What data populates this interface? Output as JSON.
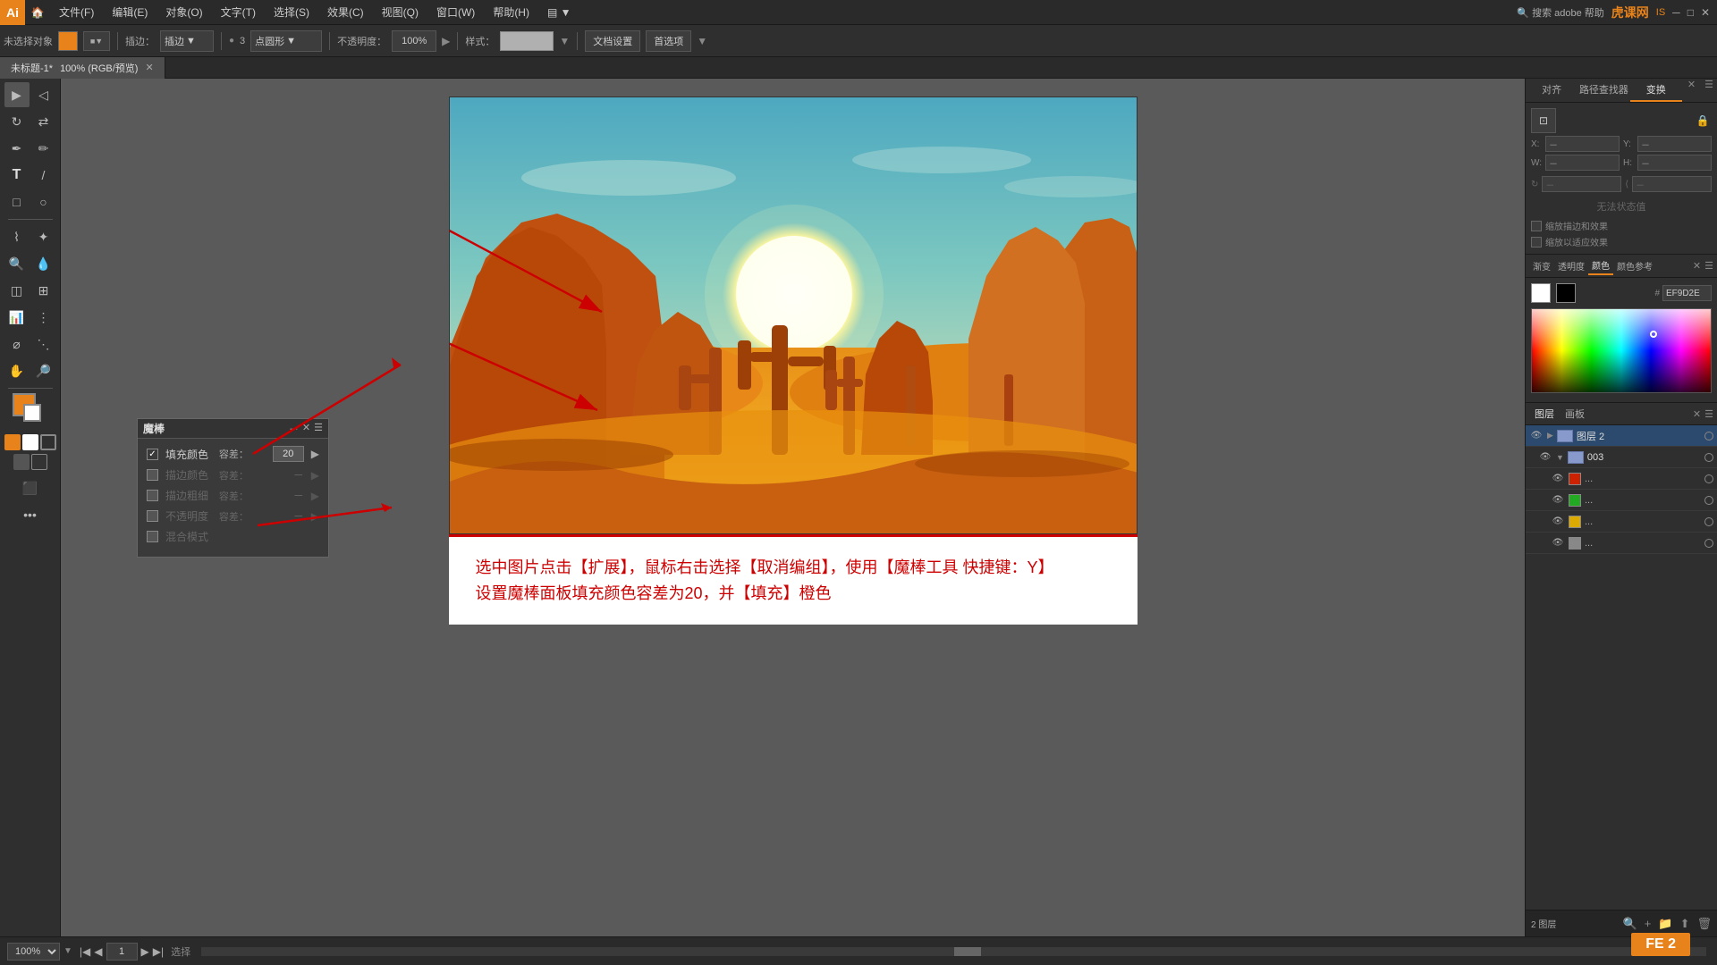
{
  "app": {
    "logo": "Ai",
    "title": "Adobe Illustrator"
  },
  "menu": {
    "items": [
      "文件(F)",
      "编辑(E)",
      "对象(O)",
      "文字(T)",
      "选择(S)",
      "效果(C)",
      "视图(Q)",
      "窗口(W)",
      "帮助(H)"
    ]
  },
  "toolbar": {
    "color_label": "未选择对象",
    "stroke_label": "描边：",
    "blend_label": "插边：",
    "opacity_label": "不透明度：",
    "opacity_value": "100%",
    "style_label": "样式：",
    "doc_btn": "文档设置",
    "pref_btn": "首选项",
    "brush_size": "3",
    "brush_type": "点圆形"
  },
  "tab": {
    "name": "未标题-1*",
    "mode": "100% (RGB/预览)"
  },
  "magic_wand": {
    "title": "魔棒",
    "fill_color_label": "填充颜色",
    "fill_color_checked": true,
    "fill_tolerance_label": "容差：",
    "fill_tolerance_value": "20",
    "stroke_color_label": "描边颜色",
    "stroke_color_checked": false,
    "stroke_tolerance_label": "容差：",
    "stroke_thickness_label": "描边粗细",
    "stroke_thickness_checked": false,
    "stroke_thickness_tolerance_label": "容差：",
    "opacity_label": "不透明度",
    "opacity_checked": false,
    "blend_mode_label": "混合模式",
    "blend_mode_checked": false
  },
  "right_panel": {
    "tabs": [
      "对齐",
      "路径查找器",
      "变换"
    ],
    "active_tab": "变换",
    "x_label": "X：",
    "y_label": "Y：",
    "w_label": "W：",
    "h_label": "H：",
    "no_selection": "无法状态值"
  },
  "color_panel": {
    "tabs": [
      "渐变",
      "透明度",
      "颜色",
      "颜色参考"
    ],
    "active_tab": "颜色",
    "hex_value": "EF9D2E",
    "hex_label": "#"
  },
  "layer_panel": {
    "tabs": [
      "图层",
      "画板"
    ],
    "active_tab": "图层",
    "items": [
      {
        "name": "图层 2",
        "level": 0,
        "expanded": true,
        "visible": true,
        "color": "#4444ff"
      },
      {
        "name": "003",
        "level": 1,
        "expanded": false,
        "visible": true,
        "color": "#4444ff"
      },
      {
        "name": "...",
        "level": 2,
        "visible": true,
        "color": "#cc2200"
      },
      {
        "name": "...",
        "level": 2,
        "visible": true,
        "color": "#22aa22"
      },
      {
        "name": "...",
        "level": 2,
        "visible": true,
        "color": "#ddaa00"
      },
      {
        "name": "...",
        "level": 2,
        "visible": true,
        "color": "#888888"
      }
    ],
    "footer_label": "2 图层"
  },
  "canvas": {
    "zoom": "100%",
    "page": "1",
    "mode_label": "选择"
  },
  "instruction": {
    "line1": "选中图片点击【扩展】，鼠标右击选择【取消编组】，使用【魔棒工具 快捷键：Y】",
    "line2": "设置魔棒面板填充颜色容差为20，并【填充】橙色"
  },
  "watermark": {
    "text": "虎课网",
    "subtext": "IS"
  }
}
